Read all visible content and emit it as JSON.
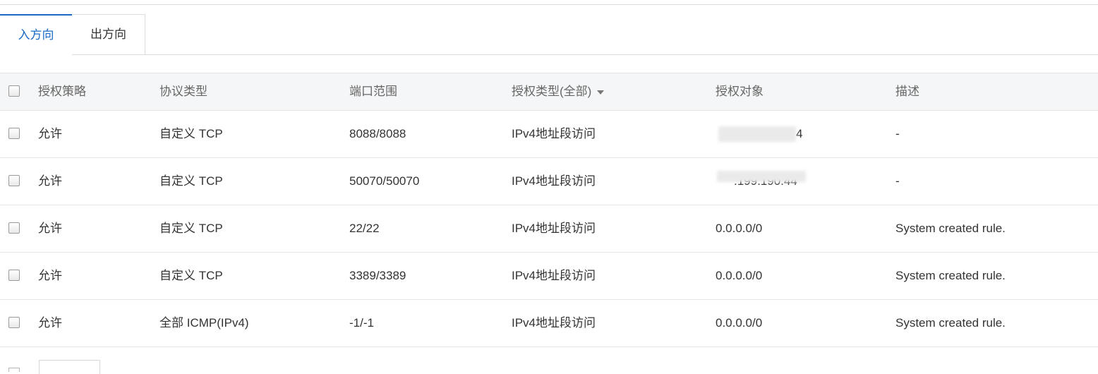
{
  "tabs": [
    {
      "label": "入方向",
      "active": true
    },
    {
      "label": "出方向",
      "active": false
    }
  ],
  "accent_color": "#1a6bc7",
  "table": {
    "headers": {
      "policy": "授权策略",
      "protocol": "协议类型",
      "port_range": "端口范围",
      "auth_type": "授权类型(全部)",
      "auth_object": "授权对象",
      "description": "描述"
    },
    "rows": [
      {
        "policy": "允许",
        "protocol": "自定义 TCP",
        "port_range": "8088/8088",
        "auth_type": "IPv4地址段访问",
        "auth_object": "4",
        "description": "-"
      },
      {
        "policy": "允许",
        "protocol": "自定义 TCP",
        "port_range": "50070/50070",
        "auth_type": "IPv4地址段访问",
        "auth_object": ".199.190.44",
        "description": "-"
      },
      {
        "policy": "允许",
        "protocol": "自定义 TCP",
        "port_range": "22/22",
        "auth_type": "IPv4地址段访问",
        "auth_object": "0.0.0.0/0",
        "description": "System created rule."
      },
      {
        "policy": "允许",
        "protocol": "自定义 TCP",
        "port_range": "3389/3389",
        "auth_type": "IPv4地址段访问",
        "auth_object": "0.0.0.0/0",
        "description": "System created rule."
      },
      {
        "policy": "允许",
        "protocol": "全部 ICMP(IPv4)",
        "port_range": "-1/-1",
        "auth_type": "IPv4地址段访问",
        "auth_object": "0.0.0.0/0",
        "description": "System created rule."
      }
    ]
  }
}
